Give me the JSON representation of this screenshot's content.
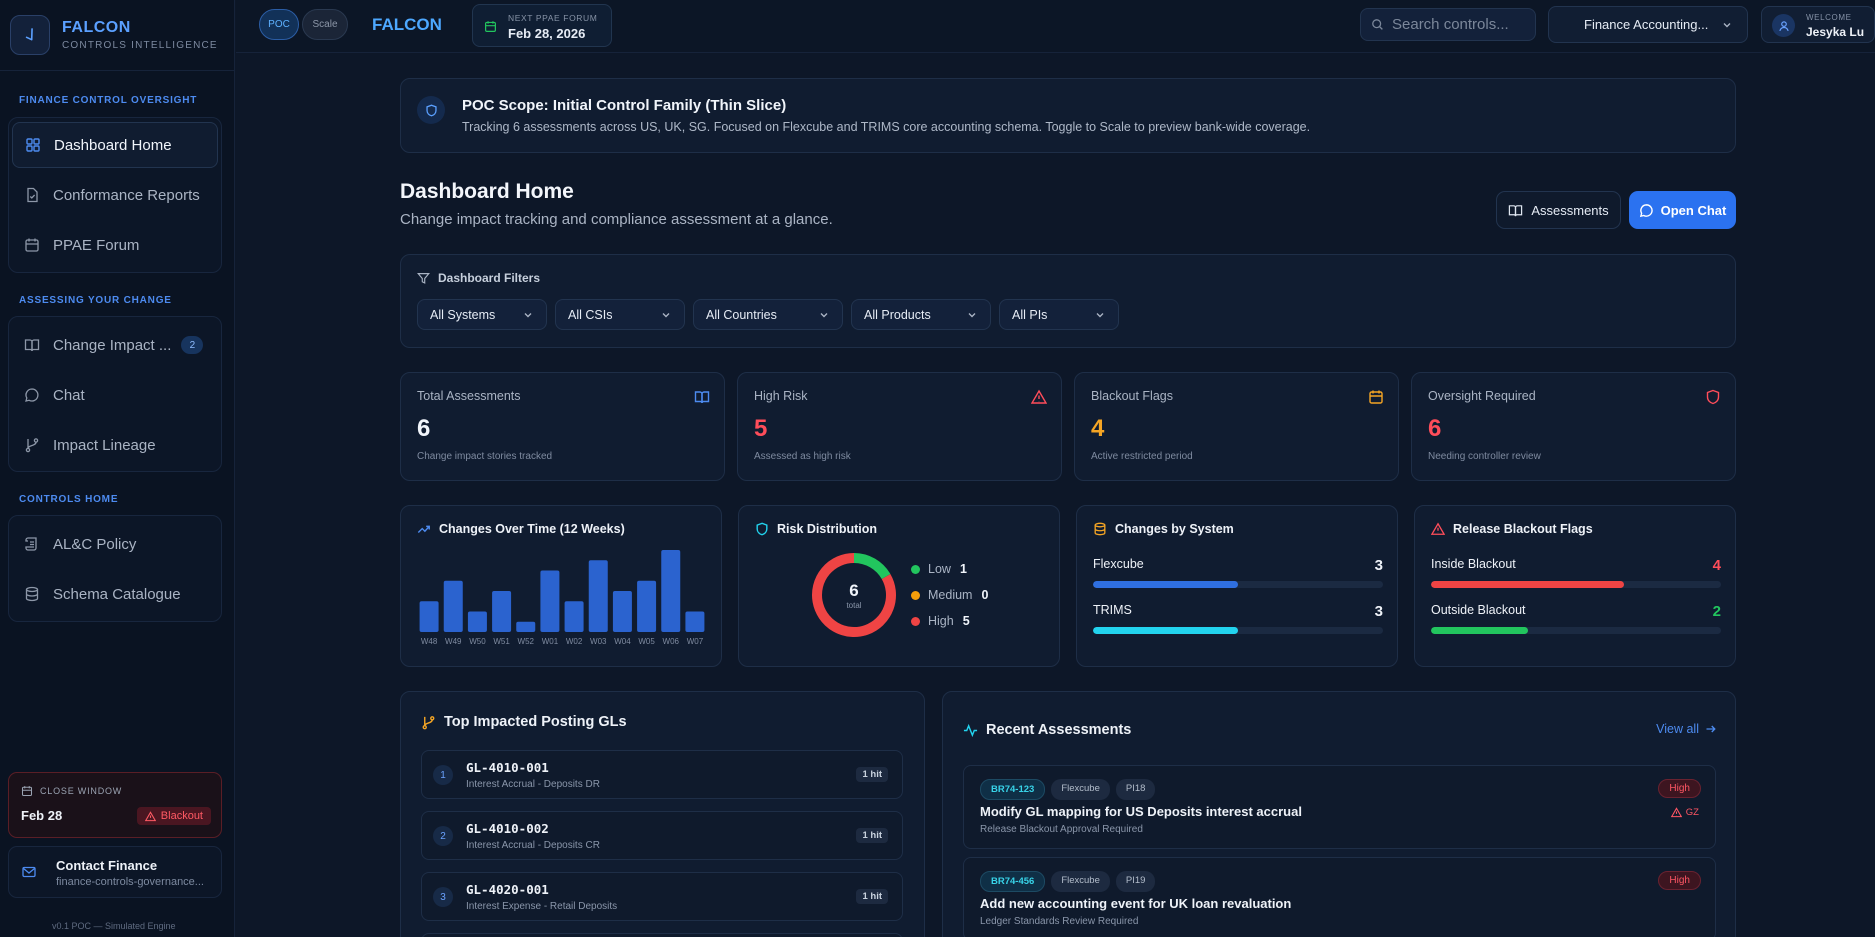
{
  "brand": {
    "name": "FALCON",
    "subtitle": "CONTROLS INTELLIGENCE"
  },
  "sidebar": {
    "sections": [
      {
        "heading": "FINANCE CONTROL OVERSIGHT",
        "items": [
          {
            "label": "Dashboard Home",
            "icon": "grid-icon",
            "active": true
          },
          {
            "label": "Conformance Reports",
            "icon": "file-check-icon"
          },
          {
            "label": "PPAE Forum",
            "icon": "calendar-icon"
          }
        ]
      },
      {
        "heading": "ASSESSING YOUR CHANGE",
        "items": [
          {
            "label": "Change Impact ...",
            "icon": "book-icon",
            "badge": "2"
          },
          {
            "label": "Chat",
            "icon": "chat-icon"
          },
          {
            "label": "Impact Lineage",
            "icon": "branch-icon"
          }
        ]
      },
      {
        "heading": "CONTROLS HOME",
        "items": [
          {
            "label": "AL&C Policy",
            "icon": "scroll-icon"
          },
          {
            "label": "Schema Catalogue",
            "icon": "database-icon"
          }
        ]
      }
    ],
    "close_window": {
      "label": "CLOSE WINDOW",
      "date": "Feb 28",
      "status": "Blackout"
    },
    "contact": {
      "title": "Contact Finance",
      "email": "finance-controls-governance..."
    },
    "version": "v0.1 POC — Simulated Engine"
  },
  "topbar": {
    "modes": [
      "POC",
      "Scale"
    ],
    "active_mode": "POC",
    "title": "FALCON",
    "forum": {
      "label": "NEXT PPAE FORUM",
      "date": "Feb 28, 2026"
    },
    "search": {
      "placeholder": "Search controls..."
    },
    "org_select": "Finance Accounting...",
    "user": {
      "welcome": "WELCOME",
      "name": "Jesyka Lu"
    }
  },
  "scope": {
    "title": "POC Scope: Initial Control Family (Thin Slice)",
    "description": "Tracking 6 assessments across US, UK, SG. Focused on Flexcube and TRIMS core accounting schema. Toggle to Scale to preview bank-wide coverage."
  },
  "page": {
    "title": "Dashboard Home",
    "subtitle": "Change impact tracking and compliance assessment at a glance.",
    "assessments_button": "Assessments",
    "chat_button": "Open Chat"
  },
  "filters": {
    "heading": "Dashboard Filters",
    "selects": [
      "All Systems",
      "All CSIs",
      "All Countries",
      "All Products",
      "All PIs"
    ]
  },
  "stats": [
    {
      "label": "Total Assessments",
      "value": "6",
      "sub": "Change impact stories tracked",
      "color": "#f1f5fb",
      "icon": "book-icon",
      "icon_color": "#4d8bf0"
    },
    {
      "label": "High Risk",
      "value": "5",
      "sub": "Assessed as high risk",
      "color": "#ff4d5a",
      "icon": "alert-icon",
      "icon_color": "#ff4d5a"
    },
    {
      "label": "Blackout Flags",
      "value": "4",
      "sub": "Active restricted period",
      "color": "#f5a524",
      "icon": "calendar-icon",
      "icon_color": "#f5a524"
    },
    {
      "label": "Oversight Required",
      "value": "6",
      "sub": "Needing controller review",
      "color": "#ff4d5a",
      "icon": "shield-icon",
      "icon_color": "#ff4d5a"
    }
  ],
  "changes_over_time": {
    "title": "Changes Over Time (12 Weeks)",
    "chart_data": {
      "type": "bar",
      "categories": [
        "W48",
        "W49",
        "W50",
        "W51",
        "W52",
        "W01",
        "W02",
        "W03",
        "W04",
        "W05",
        "W06",
        "W07"
      ],
      "values": [
        3,
        5,
        2,
        4,
        1,
        6,
        3,
        7,
        4,
        5,
        8,
        2
      ]
    }
  },
  "risk_distribution": {
    "title": "Risk Distribution",
    "total": "6",
    "total_label": "total",
    "chart_data": {
      "type": "pie",
      "labels": [
        "Low",
        "Medium",
        "High"
      ],
      "values": [
        1,
        0,
        5
      ],
      "colors": [
        "#22c55e",
        "#f59e0b",
        "#ef4444"
      ]
    }
  },
  "changes_by_system": {
    "title": "Changes by System",
    "max": 6,
    "rows": [
      {
        "label": "Flexcube",
        "value": 3,
        "color": "#2f6fe0"
      },
      {
        "label": "TRIMS",
        "value": 3,
        "color": "#22d3ee"
      }
    ]
  },
  "blackout_flags": {
    "title": "Release Blackout Flags",
    "max": 6,
    "rows": [
      {
        "label": "Inside Blackout",
        "value": 4,
        "color": "#ef4444",
        "text_color": "#ff4d5a"
      },
      {
        "label": "Outside Blackout",
        "value": 2,
        "color": "#22c55e",
        "text_color": "#22c55e"
      }
    ]
  },
  "top_gls": {
    "title": "Top Impacted Posting GLs",
    "items": [
      {
        "rank": "1",
        "code": "GL-4010-001",
        "desc": "Interest Accrual - Deposits DR",
        "hits": "1 hit"
      },
      {
        "rank": "2",
        "code": "GL-4010-002",
        "desc": "Interest Accrual - Deposits CR",
        "hits": "1 hit"
      },
      {
        "rank": "3",
        "code": "GL-4020-001",
        "desc": "Interest Expense - Retail Deposits",
        "hits": "1 hit"
      }
    ]
  },
  "recent": {
    "title": "Recent Assessments",
    "view_all": "View all",
    "items": [
      {
        "id": "BR74-123",
        "system": "Flexcube",
        "pi": "PI18",
        "title": "Modify GL mapping for US Deposits interest accrual",
        "sub": "Release Blackout Approval Required",
        "risk": "High",
        "flag": "GZ"
      },
      {
        "id": "BR74-456",
        "system": "Flexcube",
        "pi": "PI19",
        "title": "Add new accounting event for UK loan revaluation",
        "sub": "Ledger Standards Review Required",
        "risk": "High",
        "flag": ""
      }
    ]
  }
}
